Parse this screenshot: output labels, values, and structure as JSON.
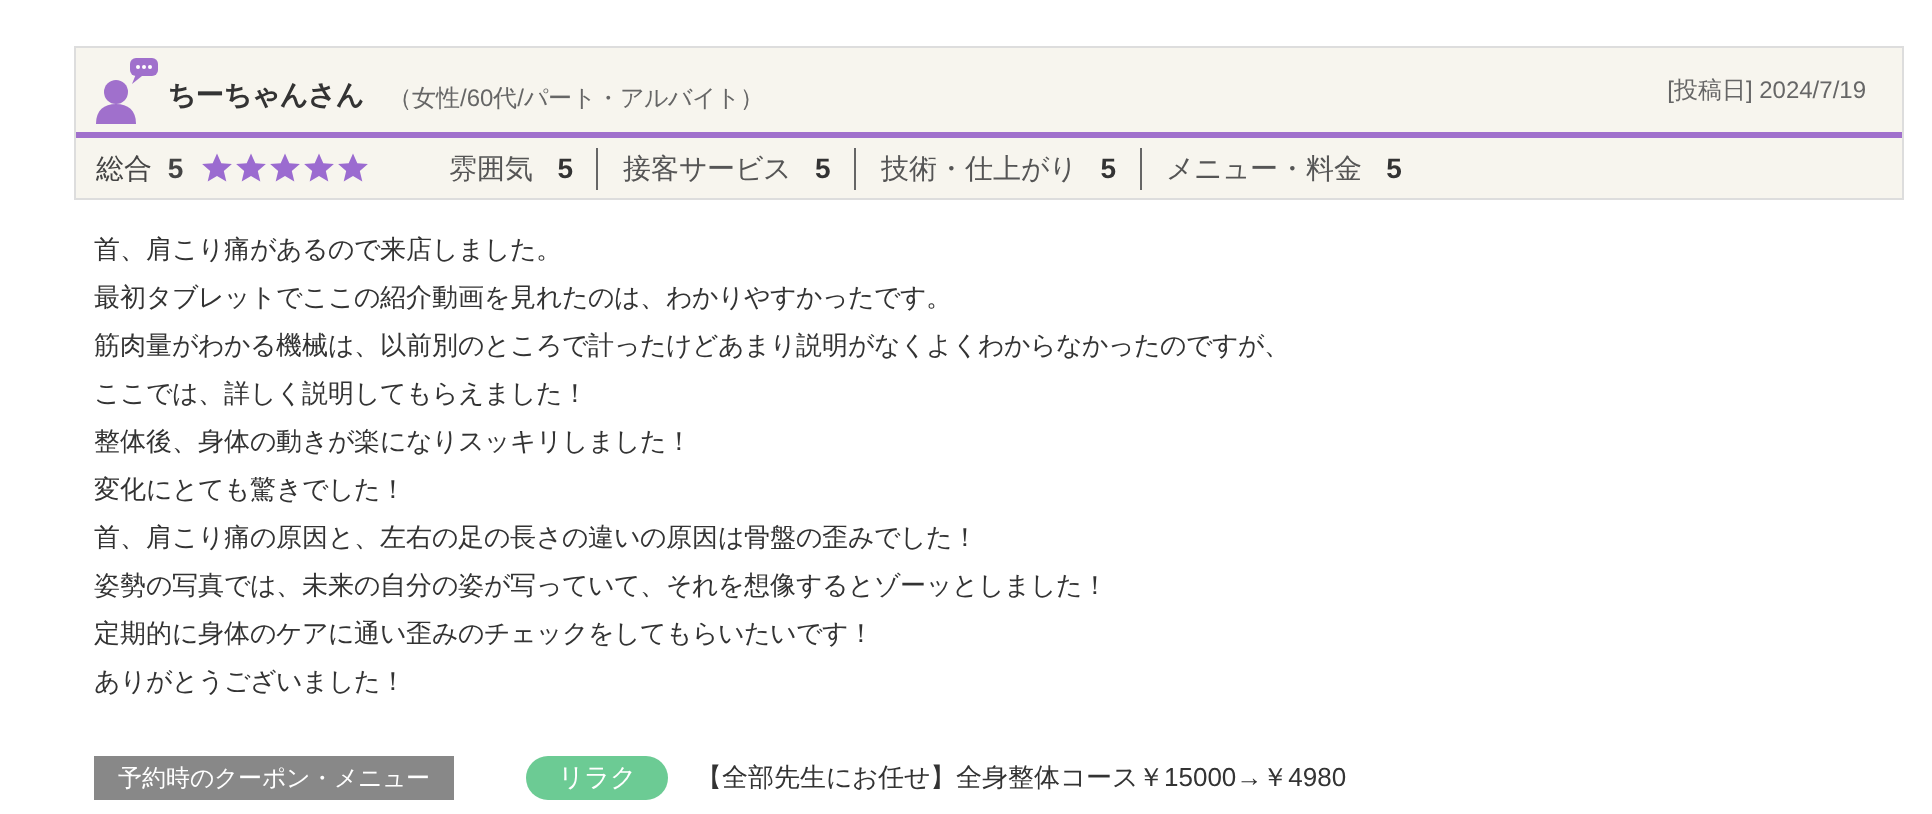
{
  "reviewer": {
    "name": "ちーちゃんさん",
    "profile": "（女性/60代/パート・アルバイト）"
  },
  "posted": "[投稿日] 2024/7/19",
  "overall": {
    "label": "総合",
    "score": "5",
    "stars": 5
  },
  "ratings": [
    {
      "label": "雰囲気",
      "score": "5"
    },
    {
      "label": "接客サービス",
      "score": "5"
    },
    {
      "label": "技術・仕上がり",
      "score": "5"
    },
    {
      "label": "メニュー・料金",
      "score": "5"
    }
  ],
  "body": [
    "首、肩こり痛があるので来店しました。",
    "最初タブレットでここの紹介動画を見れたのは、わかりやすかったです。",
    "筋肉量がわかる機械は、以前別のところで計ったけどあまり説明がなくよくわからなかったのですが、",
    "ここでは、詳しく説明してもらえました！",
    "整体後、身体の動きが楽になりスッキリしました！",
    "変化にとても驚きでした！",
    "首、肩こり痛の原因と、左右の足の長さの違いの原因は骨盤の歪みでした！",
    "姿勢の写真では、未来の自分の姿が写っていて、それを想像するとゾーッとしました！",
    "定期的に身体のケアに通い歪みのチェックをしてもらいたいです！",
    "ありがとうございました！"
  ],
  "coupon": {
    "label": "予約時のクーポン・メニュー",
    "tag": "リラク",
    "text": "【全部先生にお任せ】全身整体コース￥15000→￥4980"
  }
}
